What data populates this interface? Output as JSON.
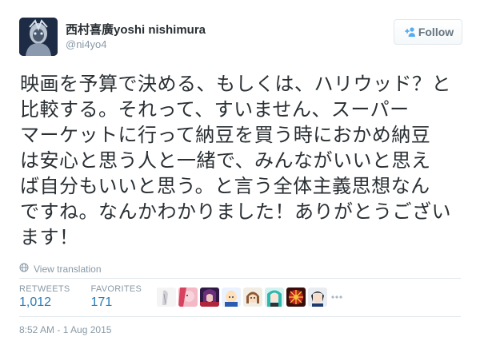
{
  "author": {
    "display_name": "西村喜廣yoshi nishimura",
    "screen_name": "@ni4yo4"
  },
  "follow_button": {
    "label": "Follow",
    "icon": "add-user-icon"
  },
  "tweet": {
    "lines": [
      "映画を予算で決める、もしくは、ハリウッド？と",
      "比較する。それって、すいません、スーパー",
      "マーケットに行って納豆を買う時におかめ納豆",
      "は安心と思う人と一緒で、みんながいいと思え",
      "ば自分もいいと思う。と言う全体主義思想なん",
      "ですね。なんかわかりました！ありがとうござい",
      "ます！"
    ]
  },
  "translation": {
    "label": "View translation",
    "icon": "globe-icon"
  },
  "stats": {
    "retweets_label": "RETWEETS",
    "retweets_value": "1,012",
    "favorites_label": "FAVORITES",
    "favorites_value": "171"
  },
  "favoriter_avatars": [
    "favoriter-avatar-1",
    "favoriter-avatar-2",
    "favoriter-avatar-3",
    "favoriter-avatar-4",
    "favoriter-avatar-5",
    "favoriter-avatar-6",
    "favoriter-avatar-7",
    "favoriter-avatar-8",
    "favoriter-avatar-9"
  ],
  "more_icon": "ellipsis-icon",
  "timestamp": "8:52 AM - 1 Aug 2015",
  "colors": {
    "link": "#2b7bb9",
    "muted": "#8899a6",
    "text": "#292f33",
    "border": "#e1e8ed"
  }
}
